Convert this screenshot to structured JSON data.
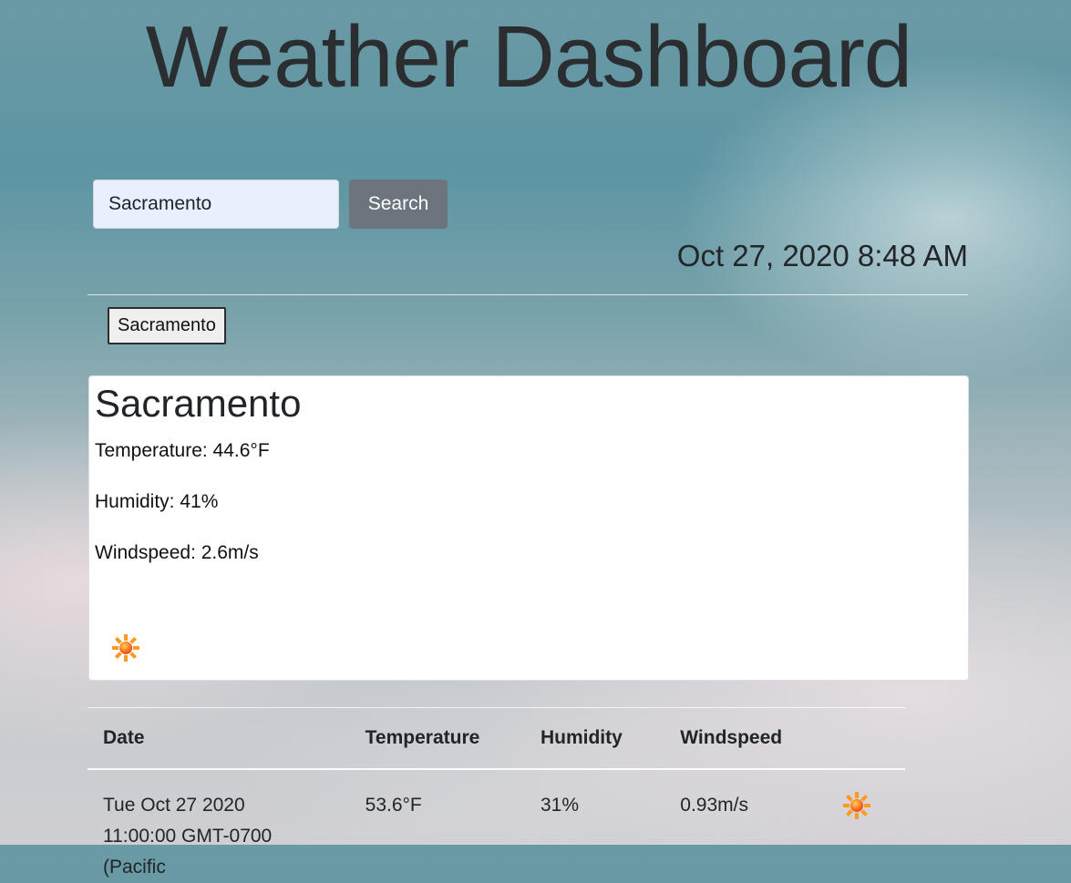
{
  "header": {
    "title": "Weather Dashboard"
  },
  "search": {
    "value": "Sacramento",
    "button_label": "Search"
  },
  "datetime": "Oct 27, 2020 8:48 AM",
  "history": [
    {
      "label": "Sacramento"
    }
  ],
  "current": {
    "city": "Sacramento",
    "temperature": "Temperature: 44.6°F",
    "humidity": "Humidity: 41%",
    "windspeed": "Windspeed: 2.6m/s",
    "icon": "sun-icon"
  },
  "forecast": {
    "headers": [
      "Date",
      "Temperature",
      "Humidity",
      "Windspeed"
    ],
    "rows": [
      {
        "date": "Tue Oct 27 2020 11:00:00 GMT-0700 (Pacific",
        "temperature": "53.6°F",
        "humidity": "31%",
        "windspeed": "0.93m/s",
        "icon": "sun-icon"
      }
    ]
  },
  "colors": {
    "search_button": "#6c757d",
    "input_autofill": "#e8f0fe",
    "card": "#ffffff"
  }
}
